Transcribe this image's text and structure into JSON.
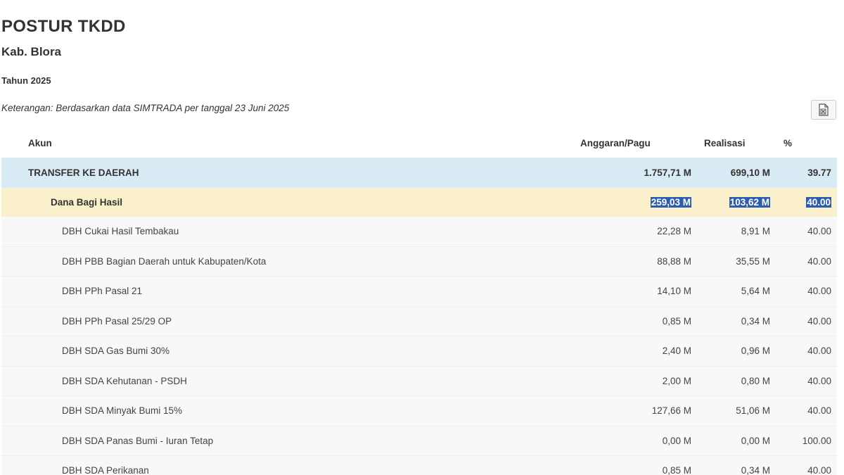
{
  "page": {
    "title": "POSTUR TKDD",
    "region": "Kab. Blora",
    "year": "Tahun 2025",
    "note": "Keterangan: Berdasarkan data SIMTRADA per tanggal 23 Juni 2025",
    "export_icon": "excel-export-icon"
  },
  "table": {
    "headers": {
      "akun": "Akun",
      "pagu": "Anggaran/Pagu",
      "realisasi": "Realisasi",
      "persen": "%"
    },
    "total": {
      "akun": "TRANSFER KE DAERAH",
      "pagu": "1.757,71 M",
      "realisasi": "699,10 M",
      "persen": "39.77"
    },
    "group": {
      "akun": "Dana Bagi Hasil",
      "pagu": "259,03 M",
      "realisasi": "103,62 M",
      "persen": "40.00"
    },
    "rows": [
      {
        "akun": "DBH Cukai Hasil Tembakau",
        "pagu": "22,28 M",
        "realisasi": "8,91 M",
        "persen": "40.00"
      },
      {
        "akun": "DBH PBB Bagian Daerah untuk Kabupaten/Kota",
        "pagu": "88,88 M",
        "realisasi": "35,55 M",
        "persen": "40.00"
      },
      {
        "akun": "DBH PPh Pasal 21",
        "pagu": "14,10 M",
        "realisasi": "5,64 M",
        "persen": "40.00"
      },
      {
        "akun": "DBH PPh Pasal 25/29 OP",
        "pagu": "0,85 M",
        "realisasi": "0,34 M",
        "persen": "40.00"
      },
      {
        "akun": "DBH SDA Gas Bumi 30%",
        "pagu": "2,40 M",
        "realisasi": "0,96 M",
        "persen": "40.00"
      },
      {
        "akun": "DBH SDA Kehutanan - PSDH",
        "pagu": "2,00 M",
        "realisasi": "0,80 M",
        "persen": "40.00"
      },
      {
        "akun": "DBH SDA Minyak Bumi 15%",
        "pagu": "127,66 M",
        "realisasi": "51,06 M",
        "persen": "40.00"
      },
      {
        "akun": "DBH SDA Panas Bumi - Iuran Tetap",
        "pagu": "0,00 M",
        "realisasi": "0,00 M",
        "persen": "100.00"
      },
      {
        "akun": "DBH SDA Perikanan",
        "pagu": "0,85 M",
        "realisasi": "0,34 M",
        "persen": "40.00"
      }
    ]
  },
  "colors": {
    "total_row_bg": "#d9ebf5",
    "group_row_bg": "#faf0cc",
    "detail_row_bg": "#f8f8f8",
    "selection_bg": "#2a5db0"
  }
}
